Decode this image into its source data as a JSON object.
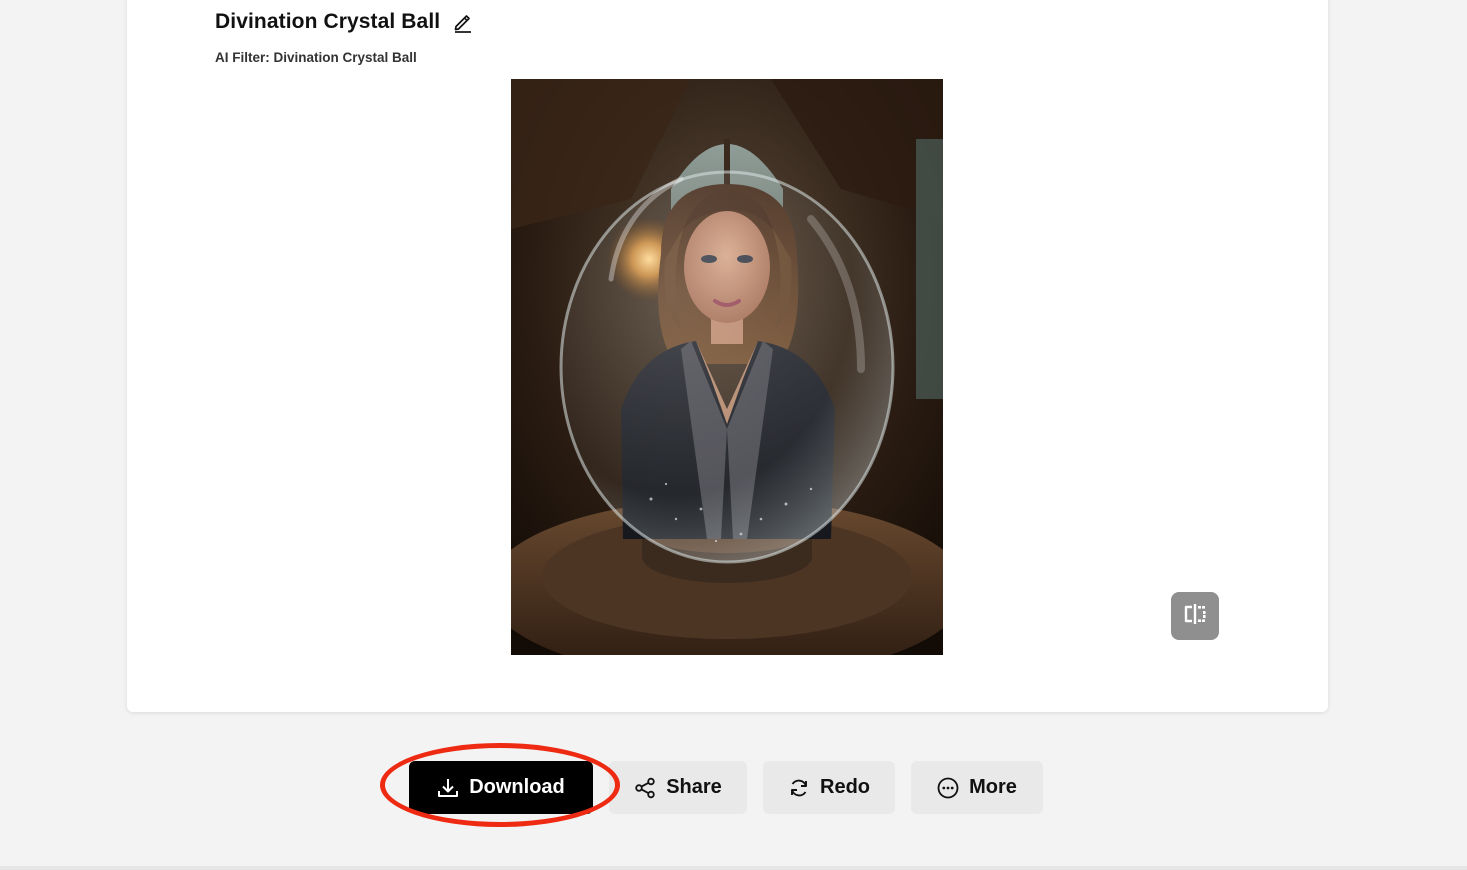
{
  "header": {
    "title": "Divination Crystal Ball",
    "subtitle": "AI Filter: Divination Crystal Ball"
  },
  "icons": {
    "edit": "pencil-icon",
    "compare": "compare-icon",
    "download": "download-icon",
    "share": "share-icon",
    "redo": "redo-icon",
    "more": "more-icon"
  },
  "actions": {
    "download_label": "Download",
    "share_label": "Share",
    "redo_label": "Redo",
    "more_label": "More"
  },
  "colors": {
    "primary_button": "#000000",
    "secondary_button": "#e9e9e9",
    "highlight_annotation": "#ee2a12"
  }
}
